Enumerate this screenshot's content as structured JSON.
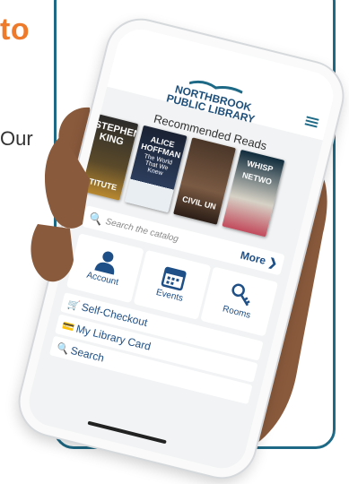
{
  "headline": "to",
  "intro_text": "Our",
  "app": {
    "logo_line1": "NORTHBROOK",
    "logo_line2": "PUBLIC LIBRARY",
    "recommended_title": "Recommended Reads",
    "books": [
      {
        "text": "STEPHEN KING",
        "sub": "STITUTE"
      },
      {
        "text": "ALICE HOFFMAN",
        "sub": "The World That We Knew"
      },
      {
        "text": "",
        "sub": "CIVIL UN"
      },
      {
        "text": "WHISP",
        "sub": "NETWO"
      }
    ],
    "search_placeholder": "Search the catalog",
    "more_label": "More",
    "tiles": [
      {
        "label": "Account",
        "icon": "person-icon"
      },
      {
        "label": "Events",
        "icon": "calendar-icon"
      },
      {
        "label": "Rooms",
        "icon": "key-icon"
      }
    ],
    "menu": [
      {
        "label": "Self-Checkout",
        "icon": "basket-icon"
      },
      {
        "label": "My Library Card",
        "icon": "card-icon"
      },
      {
        "label": "Search",
        "icon": "search-icon"
      }
    ]
  },
  "colors": {
    "accent_orange": "#ee7a2c",
    "brand_blue": "#1e4f86",
    "frame_teal": "#1e6a86",
    "skin": "#8a5a3c"
  }
}
